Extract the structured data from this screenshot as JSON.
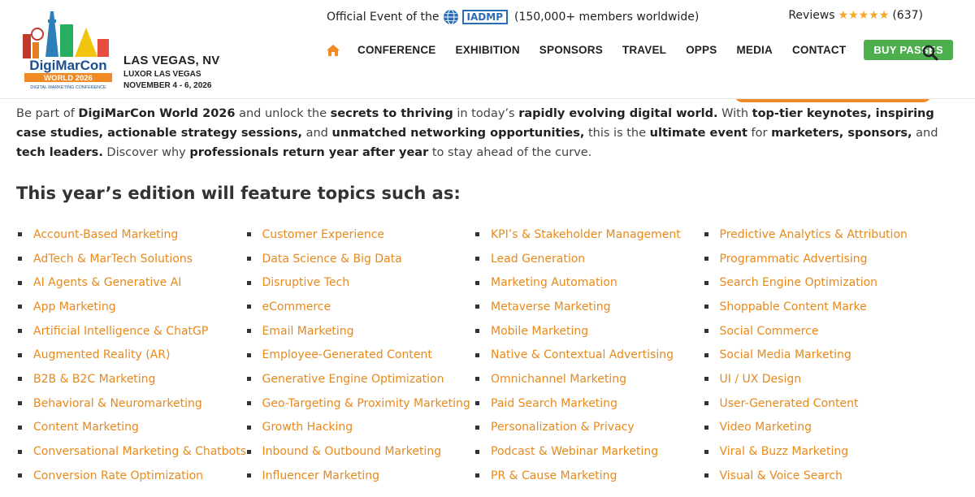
{
  "header": {
    "logo": {
      "brand": "DigiMarCon",
      "edition": "WORLD 2026",
      "tagline": "DIGITAL MARKETING CONFERENCE"
    },
    "event": {
      "city": "LAS VEGAS, NV",
      "venue": "LUXOR LAS VEGAS",
      "dates": "NOVEMBER 4 - 6, 2026"
    },
    "official": {
      "prefix": "Official Event of the",
      "org": "IADMP",
      "members": "(150,000+ members worldwide)"
    },
    "reviews": {
      "label": "Reviews",
      "stars": "★★★★★",
      "count": "(637)"
    },
    "nav": {
      "items": [
        "CONFERENCE",
        "EXHIBITION",
        "SPONSORS",
        "TRAVEL",
        "OPPS",
        "MEDIA",
        "CONTACT"
      ],
      "buy_label": "BUY PASSES"
    },
    "colors": {
      "accent": "#f08a24",
      "buy": "#4cae4c",
      "link": "#e8891b"
    }
  },
  "intro": {
    "segments": [
      {
        "t": "Be part of ",
        "b": false
      },
      {
        "t": "DigiMarCon World 2026",
        "b": true
      },
      {
        "t": " and unlock the ",
        "b": false
      },
      {
        "t": "secrets to thriving",
        "b": true
      },
      {
        "t": " in today’s ",
        "b": false
      },
      {
        "t": "rapidly evolving digital world.",
        "b": true
      },
      {
        "t": " With ",
        "b": false
      },
      {
        "t": "top-tier keynotes, inspiring case studies, actionable strategy sessions,",
        "b": true
      },
      {
        "t": " and ",
        "b": false
      },
      {
        "t": "unmatched networking opportunities,",
        "b": true
      },
      {
        "t": " this is the ",
        "b": false
      },
      {
        "t": "ultimate event",
        "b": true
      },
      {
        "t": " for ",
        "b": false
      },
      {
        "t": "marketers, sponsors,",
        "b": true
      },
      {
        "t": " and ",
        "b": false
      },
      {
        "t": "tech leaders.",
        "b": true
      },
      {
        "t": " Discover why ",
        "b": false
      },
      {
        "t": "professionals return year after year",
        "b": true
      },
      {
        "t": " to stay ahead of the curve.",
        "b": false
      }
    ]
  },
  "topics": {
    "heading": "This year’s edition will feature topics such as:",
    "columns": [
      [
        "Account-Based Marketing",
        "AdTech & MarTech Solutions",
        "AI Agents & Generative AI",
        "App Marketing",
        "Artificial Intelligence & ChatGP",
        "Augmented Reality (AR)",
        "B2B & B2C Marketing",
        "Behavioral & Neuromarketing",
        "Content Marketing",
        "Conversational Marketing & Chatbots",
        "Conversion Rate Optimization"
      ],
      [
        "Customer Experience",
        "Data Science & Big Data",
        "Disruptive Tech",
        "eCommerce",
        "Email Marketing",
        "Employee-Generated Content",
        "Generative Engine Optimization",
        "Geo-Targeting & Proximity Marketing",
        "Growth Hacking",
        "Inbound & Outbound Marketing",
        "Influencer Marketing"
      ],
      [
        "KPI’s & Stakeholder Management",
        "Lead Generation",
        "Marketing Automation",
        "Metaverse Marketing",
        "Mobile Marketing",
        "Native & Contextual Advertising",
        "Omnichannel Marketing",
        "Paid Search Marketing",
        "Personalization & Privacy",
        "Podcast & Webinar Marketing",
        "PR & Cause Marketing"
      ],
      [
        "Predictive Analytics & Attribution",
        "Programmatic Advertising",
        "Search Engine Optimization",
        "Shoppable Content Marke",
        "Social Commerce",
        "Social Media Marketing",
        "UI / UX Design",
        "User-Generated Content",
        "Video Marketing",
        "Viral & Buzz Marketing",
        "Visual & Voice Search"
      ]
    ]
  }
}
